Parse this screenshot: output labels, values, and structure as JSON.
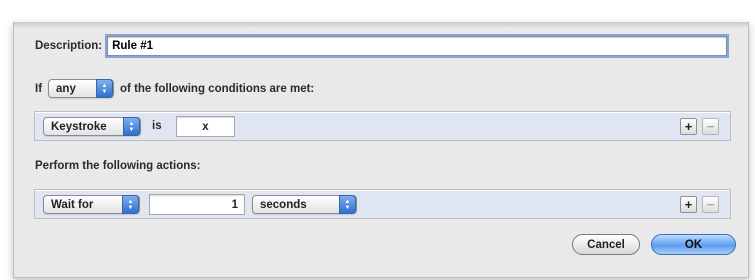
{
  "description": {
    "label": "Description:",
    "value": "Rule #1"
  },
  "condition_header": {
    "prefix": "If",
    "match_select": "any",
    "suffix": "of the following conditions are met:"
  },
  "condition_row": {
    "field_select": "Keystroke",
    "operator": "is",
    "value": "x",
    "add": "+",
    "remove": "−"
  },
  "actions_header": {
    "label": "Perform the following actions:"
  },
  "action_row": {
    "action_select": "Wait for",
    "amount": "1",
    "unit_select": "seconds",
    "add": "+",
    "remove": "−"
  },
  "buttons": {
    "cancel": "Cancel",
    "ok": "OK"
  }
}
